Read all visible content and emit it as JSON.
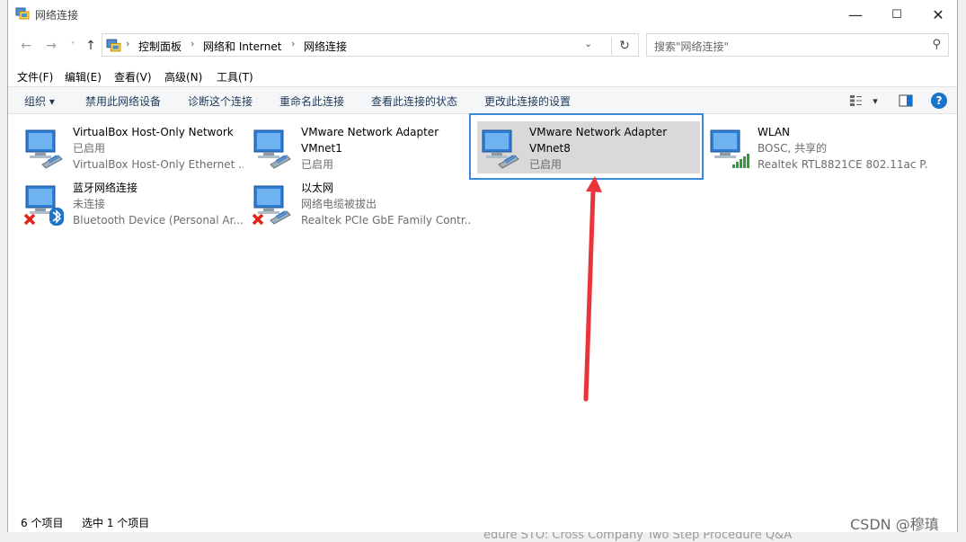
{
  "window": {
    "title": "网络连接",
    "controls": {
      "minimize": "—",
      "maximize": "☐",
      "close": "✕"
    }
  },
  "nav": {
    "back": "←",
    "forward": "→",
    "recent": "˅",
    "up": "↑",
    "breadcrumbs": [
      "控制面板",
      "网络和 Internet",
      "网络连接"
    ],
    "separator": "›",
    "dropdown": "⌄",
    "refresh": "↻"
  },
  "search": {
    "placeholder": "搜索\"网络连接\"",
    "icon": "⚲"
  },
  "menubar": [
    "文件(F)",
    "编辑(E)",
    "查看(V)",
    "高级(N)",
    "工具(T)"
  ],
  "commands": {
    "organize": "组织 ▾",
    "items": [
      "禁用此网络设备",
      "诊断这个连接",
      "重命名此连接",
      "查看此连接的状态",
      "更改此连接的设置"
    ],
    "view_toggle": "▾",
    "help": "?"
  },
  "connections": [
    {
      "name": "VirtualBox Host-Only Network",
      "status": "已启用",
      "device": "VirtualBox Host-Only Ethernet ...",
      "icon": "ethernet-icon",
      "badge": ""
    },
    {
      "name": "VMware Network Adapter",
      "status": "VMnet1",
      "device": "已启用",
      "icon": "ethernet-icon",
      "badge": ""
    },
    {
      "name": "VMware Network Adapter",
      "status": "VMnet8",
      "device": "已启用",
      "icon": "ethernet-icon",
      "badge": "",
      "selected": true
    },
    {
      "name": "WLAN",
      "status": "BOSC, 共享的",
      "device": "Realtek RTL8821CE 802.11ac P...",
      "icon": "wifi-icon",
      "badge": "signal"
    },
    {
      "name": "蓝牙网络连接",
      "status": "未连接",
      "device": "Bluetooth Device (Personal Ar...",
      "icon": "bluetooth-icon",
      "badge": "x"
    },
    {
      "name": "以太网",
      "status": "网络电缆被拔出",
      "device": "Realtek PCIe GbE Family Contr...",
      "icon": "ethernet-icon",
      "badge": "x"
    }
  ],
  "status": {
    "count": "6 个项目",
    "selected": "选中 1 个项目"
  },
  "background": {
    "text": "edure STO: Cross Company Two Step Procedure Q&A",
    "watermark": "CSDN @穆瑱"
  },
  "colors": {
    "accent": "#1a73c9",
    "selection_border": "#3a8ad8",
    "arrow": "#e8343a",
    "selection_bg": "#d9d9d9"
  }
}
